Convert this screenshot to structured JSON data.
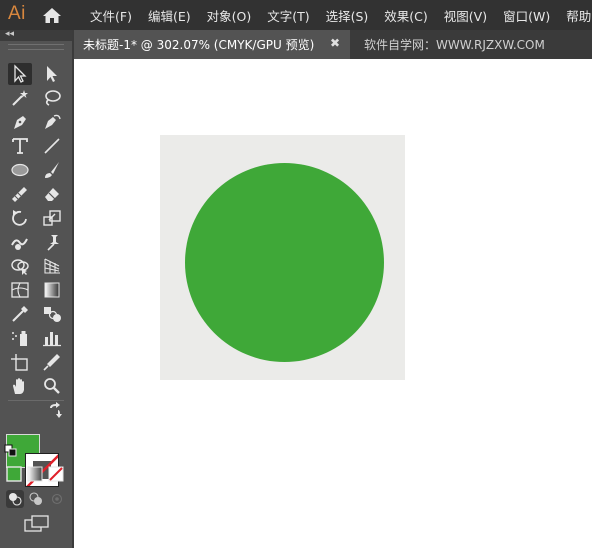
{
  "app": {
    "logo_text": "Ai"
  },
  "menu": [
    {
      "label": "文件(F)"
    },
    {
      "label": "编辑(E)"
    },
    {
      "label": "对象(O)"
    },
    {
      "label": "文字(T)"
    },
    {
      "label": "选择(S)"
    },
    {
      "label": "效果(C)"
    },
    {
      "label": "视图(V)"
    },
    {
      "label": "窗口(W)"
    },
    {
      "label": "帮助(H)"
    }
  ],
  "tabs": {
    "active_title": "未标题-1* @ 302.07% (CMYK/GPU 预览)",
    "close_glyph": "✖",
    "second_tab": "软件自学网：WWW.RJZXW.COM"
  },
  "toolbar": {
    "collapse_glyph": "◂◂"
  },
  "colors": {
    "fill": "#3fa838",
    "accent_logo": "#d8873e",
    "artboard": "#ebebe9",
    "menubar": "#323232",
    "panel": "#535353"
  },
  "tool_icons": [
    "selection-tool-icon",
    "direct-selection-tool-icon",
    "magic-wand-tool-icon",
    "lasso-tool-icon",
    "pen-tool-icon",
    "curvature-tool-icon",
    "type-tool-icon",
    "line-segment-tool-icon",
    "ellipse-tool-icon",
    "paintbrush-tool-icon",
    "shaper-tool-icon",
    "eraser-tool-icon",
    "rotate-tool-icon",
    "scale-tool-icon",
    "warp-tool-icon",
    "puppet-warp-tool-icon",
    "shape-builder-tool-icon",
    "perspective-grid-tool-icon",
    "mesh-tool-icon",
    "gradient-tool-icon",
    "eyedropper-tool-icon",
    "blend-tool-icon",
    "symbol-sprayer-tool-icon",
    "column-graph-tool-icon",
    "artboard-tool-icon",
    "slice-tool-icon",
    "hand-tool-icon",
    "zoom-tool-icon"
  ]
}
